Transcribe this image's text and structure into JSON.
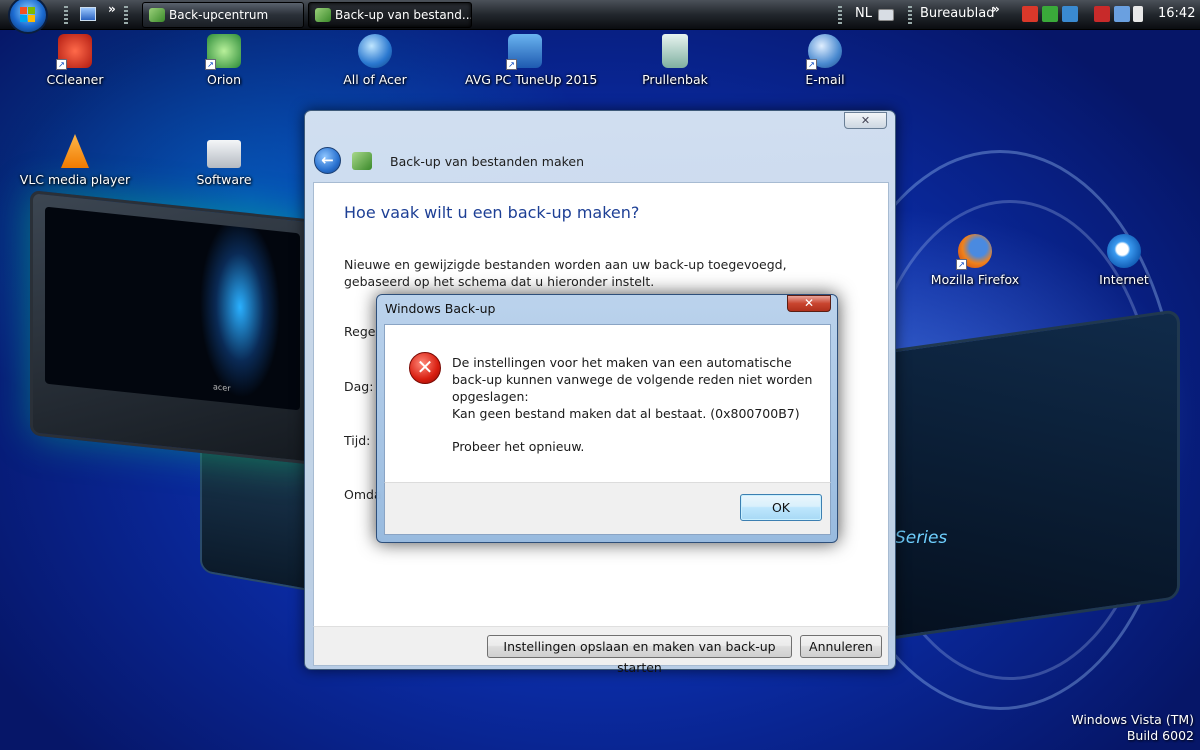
{
  "taskbar": {
    "buttons": [
      {
        "label": "Back-upcentrum",
        "active": false
      },
      {
        "label": "Back-up van bestand...",
        "active": true
      }
    ],
    "language": "NL",
    "toolbar_label": "Bureaublad",
    "chevron": "»",
    "clock": "16:42"
  },
  "desktop": {
    "icons": [
      {
        "label": "CCleaner",
        "icon": "ccleaner-icon",
        "color": "#d9382a"
      },
      {
        "label": "Orion",
        "icon": "orion-icon",
        "color": "#3aa048"
      },
      {
        "label": "All of Acer",
        "icon": "acer-globe-icon",
        "color": "#2f7fd0"
      },
      {
        "label": "AVG PC TuneUp 2015",
        "icon": "avg-tuneup-icon",
        "color": "#2e6fc0"
      },
      {
        "label": "Prullenbak",
        "icon": "recycle-bin-icon",
        "color": "#7fb0a0"
      },
      {
        "label": "E-mail",
        "icon": "email-icon",
        "color": "#4a8ad0"
      },
      {
        "label": "VLC media player",
        "icon": "vlc-icon",
        "color": "#f08a00"
      },
      {
        "label": "Software",
        "icon": "folder-icon",
        "color": "#c8ccd2"
      },
      {
        "label": "Mozilla Firefox",
        "icon": "firefox-icon",
        "color": "#e8721c"
      },
      {
        "label": "Internet",
        "icon": "internet-explorer-icon",
        "color": "#2f8be0"
      }
    ],
    "watermark": {
      "line1": "Windows Vista (TM)",
      "line2": "Build 6002"
    },
    "wallpaper_text": "Series"
  },
  "wizard": {
    "close_glyph": "✕",
    "back_glyph": "←",
    "title": "Back-up van bestanden maken",
    "heading": "Hoe vaak wilt u een back-up maken?",
    "description": "Nieuwe en gewijzigde bestanden worden aan uw back-up toegevoegd, gebaseerd op het schema dat u hieronder instelt.",
    "field_labels": [
      "Regel",
      "Dag:",
      "Tijd:",
      "Omda"
    ],
    "save_button": "Instellingen opslaan en maken van back-up starten",
    "cancel_button": "Annuleren"
  },
  "error_dialog": {
    "title": "Windows Back-up",
    "close_glyph": "✕",
    "icon_glyph": "✕",
    "message": "De instellingen voor het maken van een automatische back-up kunnen vanwege de volgende reden niet worden opgeslagen:",
    "error_detail": "Kan geen bestand maken dat al bestaat. (0x800700B7)",
    "retry_hint": "Probeer het opnieuw.",
    "ok_button": "OK"
  }
}
